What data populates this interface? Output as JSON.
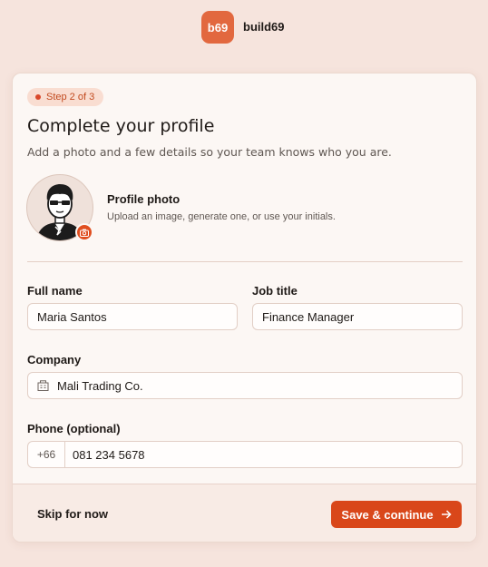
{
  "brand": {
    "logo_text": "b69",
    "name": "build69"
  },
  "step": {
    "label": "Step 2 of 3"
  },
  "header": {
    "title": "Complete your profile",
    "subtitle": "Add a photo and a few details so your team knows who you are."
  },
  "photo": {
    "label": "Profile photo",
    "help": "Upload an image, generate one, or use your initials."
  },
  "form": {
    "full_name": {
      "label": "Full name",
      "value": "Maria Santos"
    },
    "job_title": {
      "label": "Job title",
      "value": "Finance Manager"
    },
    "company": {
      "label": "Company",
      "value": "Mali Trading Co.",
      "icon": "building-icon"
    },
    "phone": {
      "label": "Phone (optional)",
      "prefix": "+66",
      "value": "081 234 5678"
    }
  },
  "footer": {
    "skip_label": "Skip for now",
    "save_label": "Save & continue"
  },
  "colors": {
    "accent": "#d9471a",
    "background": "#f6e4dd",
    "card": "#fcf7f4"
  }
}
